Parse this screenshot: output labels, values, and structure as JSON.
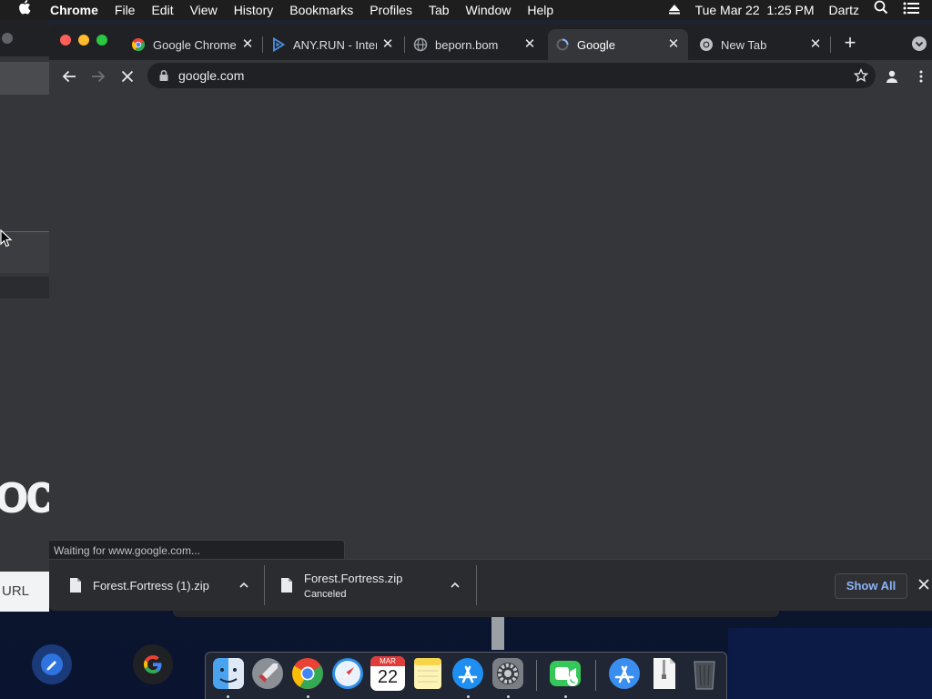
{
  "menubar": {
    "app_name": "Chrome",
    "menus": [
      "File",
      "Edit",
      "View",
      "History",
      "Bookmarks",
      "Profiles",
      "Tab",
      "Window",
      "Help"
    ],
    "datetime": "Tue Mar 22  1:25 PM",
    "user": "Dartz"
  },
  "background_window": {
    "url_fragment": "URL",
    "logo_fragment": "oc"
  },
  "tabs": [
    {
      "title": "Google Chrome",
      "icon": "chrome-icon"
    },
    {
      "title": "ANY.RUN - Interactive",
      "icon": "anyrun-icon"
    },
    {
      "title": "beporn.bom",
      "icon": "globe-icon"
    },
    {
      "title": "Google",
      "icon": "loading-icon",
      "active": true
    },
    {
      "title": "New Tab",
      "icon": "chrome-icon"
    }
  ],
  "omnibox": {
    "url": "google.com"
  },
  "status_text": "Waiting for www.google.com...",
  "downloads": [
    {
      "name": "Forest.Fortress (1).zip",
      "status": ""
    },
    {
      "name": "Forest.Fortress.zip",
      "status": "Canceled"
    }
  ],
  "show_all_label": "Show All",
  "dock": {
    "calendar_month": "MAR",
    "calendar_day": "22",
    "apps": [
      "finder",
      "launchpad",
      "chrome",
      "safari",
      "calendar",
      "notes",
      "app-store",
      "system-preferences",
      "facetime",
      "app-store-2",
      "zip-archive",
      "trash"
    ]
  },
  "colors": {
    "accent": "#8ab4f8",
    "tabstrip": "#202124",
    "toolbar": "#35363a"
  }
}
